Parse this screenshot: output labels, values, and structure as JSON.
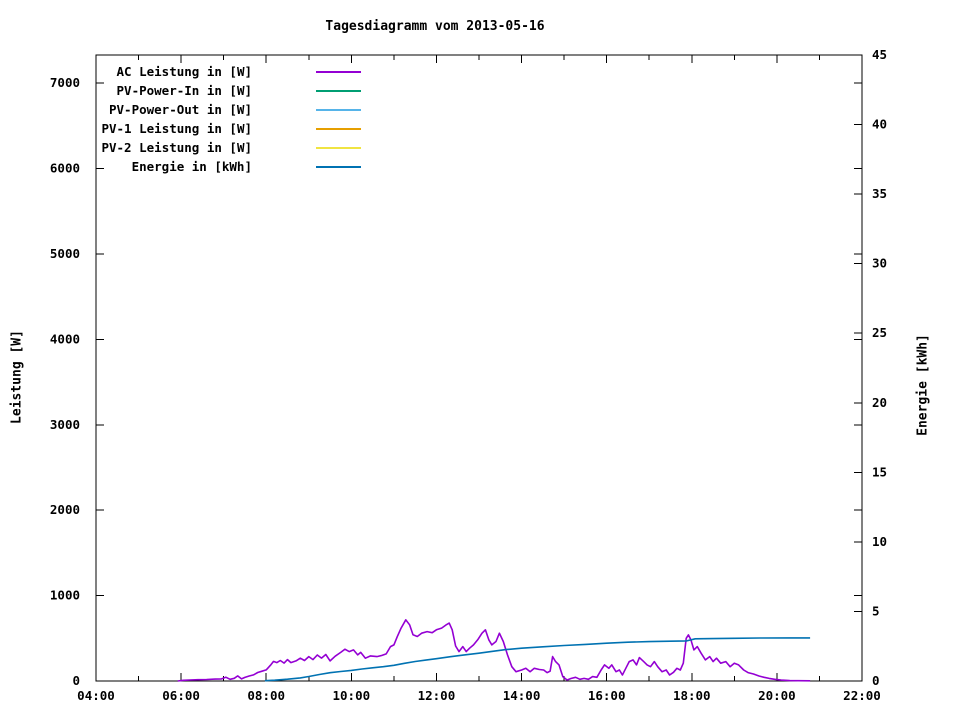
{
  "colors": {
    "background": "#ffffff",
    "axis": "#000000",
    "text": "#000000"
  },
  "chart_data": {
    "type": "line",
    "title": "Tagesdiagramm vom 2013-05-16",
    "grid": false,
    "legend_position": "top-left-inside",
    "x_axis": {
      "label": "",
      "min_hour": 4,
      "max_hour": 22,
      "major_tick_hours": [
        4,
        6,
        8,
        10,
        12,
        14,
        16,
        18,
        20,
        22
      ],
      "major_tick_labels": [
        "04:00",
        "06:00",
        "08:00",
        "10:00",
        "12:00",
        "14:00",
        "16:00",
        "18:00",
        "20:00",
        "22:00"
      ],
      "minor_tick_hours": [
        5,
        7,
        9,
        11,
        13,
        15,
        17,
        19,
        21
      ]
    },
    "y_left_axis": {
      "label": "Leistung [W]",
      "min": 0,
      "max": 7330,
      "tick_values": [
        0,
        1000,
        2000,
        3000,
        4000,
        5000,
        6000,
        7000
      ],
      "tick_labels": [
        "0",
        "1000",
        "2000",
        "3000",
        "4000",
        "5000",
        "6000",
        "7000"
      ]
    },
    "y_right_axis": {
      "label": "Energie [kWh]",
      "min": 0,
      "max": 45,
      "tick_values": [
        0,
        5,
        10,
        15,
        20,
        25,
        30,
        35,
        40,
        45
      ],
      "tick_labels": [
        "0",
        "5",
        "10",
        "15",
        "20",
        "25",
        "30",
        "35",
        "40",
        "45"
      ]
    },
    "series": [
      {
        "name": "AC Leistung in [W]",
        "slug": "ac-leistung",
        "color": "#9400D3",
        "axis": "left",
        "points": [
          [
            5.92,
            0
          ],
          [
            6.05,
            8
          ],
          [
            6.2,
            12
          ],
          [
            6.4,
            15
          ],
          [
            6.6,
            18
          ],
          [
            6.8,
            22
          ],
          [
            6.95,
            25
          ],
          [
            7.05,
            45
          ],
          [
            7.15,
            20
          ],
          [
            7.25,
            32
          ],
          [
            7.33,
            60
          ],
          [
            7.42,
            25
          ],
          [
            7.5,
            42
          ],
          [
            7.6,
            58
          ],
          [
            7.7,
            72
          ],
          [
            7.8,
            100
          ],
          [
            7.9,
            115
          ],
          [
            8.0,
            130
          ],
          [
            8.1,
            185
          ],
          [
            8.17,
            230
          ],
          [
            8.25,
            215
          ],
          [
            8.33,
            240
          ],
          [
            8.42,
            210
          ],
          [
            8.5,
            250
          ],
          [
            8.58,
            215
          ],
          [
            8.7,
            235
          ],
          [
            8.8,
            267
          ],
          [
            8.9,
            240
          ],
          [
            9.0,
            286
          ],
          [
            9.1,
            250
          ],
          [
            9.2,
            305
          ],
          [
            9.3,
            268
          ],
          [
            9.4,
            310
          ],
          [
            9.5,
            235
          ],
          [
            9.62,
            290
          ],
          [
            9.75,
            335
          ],
          [
            9.85,
            372
          ],
          [
            9.95,
            344
          ],
          [
            10.05,
            364
          ],
          [
            10.15,
            306
          ],
          [
            10.22,
            335
          ],
          [
            10.33,
            267
          ],
          [
            10.45,
            294
          ],
          [
            10.6,
            286
          ],
          [
            10.72,
            300
          ],
          [
            10.82,
            317
          ],
          [
            10.92,
            403
          ],
          [
            11.0,
            423
          ],
          [
            11.08,
            520
          ],
          [
            11.17,
            620
          ],
          [
            11.28,
            717
          ],
          [
            11.37,
            658
          ],
          [
            11.45,
            541
          ],
          [
            11.55,
            521
          ],
          [
            11.65,
            560
          ],
          [
            11.78,
            579
          ],
          [
            11.9,
            565
          ],
          [
            12.0,
            599
          ],
          [
            12.12,
            619
          ],
          [
            12.22,
            655
          ],
          [
            12.3,
            678
          ],
          [
            12.37,
            600
          ],
          [
            12.45,
            410
          ],
          [
            12.53,
            344
          ],
          [
            12.62,
            403
          ],
          [
            12.7,
            344
          ],
          [
            12.78,
            384
          ],
          [
            12.87,
            423
          ],
          [
            12.97,
            482
          ],
          [
            13.07,
            560
          ],
          [
            13.15,
            600
          ],
          [
            13.23,
            482
          ],
          [
            13.3,
            423
          ],
          [
            13.4,
            462
          ],
          [
            13.48,
            560
          ],
          [
            13.57,
            462
          ],
          [
            13.67,
            306
          ],
          [
            13.77,
            168
          ],
          [
            13.87,
            109
          ],
          [
            14.0,
            129
          ],
          [
            14.1,
            149
          ],
          [
            14.2,
            109
          ],
          [
            14.3,
            149
          ],
          [
            14.42,
            135
          ],
          [
            14.52,
            129
          ],
          [
            14.6,
            98
          ],
          [
            14.67,
            115
          ],
          [
            14.73,
            286
          ],
          [
            14.8,
            227
          ],
          [
            14.88,
            188
          ],
          [
            14.97,
            51
          ],
          [
            15.07,
            12
          ],
          [
            15.17,
            31
          ],
          [
            15.27,
            43
          ],
          [
            15.37,
            20
          ],
          [
            15.47,
            31
          ],
          [
            15.57,
            20
          ],
          [
            15.67,
            51
          ],
          [
            15.77,
            43
          ],
          [
            15.87,
            129
          ],
          [
            15.95,
            188
          ],
          [
            16.05,
            149
          ],
          [
            16.12,
            188
          ],
          [
            16.22,
            109
          ],
          [
            16.3,
            129
          ],
          [
            16.37,
            70
          ],
          [
            16.45,
            149
          ],
          [
            16.53,
            227
          ],
          [
            16.62,
            247
          ],
          [
            16.7,
            188
          ],
          [
            16.77,
            274
          ],
          [
            16.87,
            227
          ],
          [
            16.95,
            188
          ],
          [
            17.03,
            168
          ],
          [
            17.12,
            227
          ],
          [
            17.2,
            168
          ],
          [
            17.3,
            109
          ],
          [
            17.4,
            129
          ],
          [
            17.48,
            70
          ],
          [
            17.57,
            102
          ],
          [
            17.65,
            149
          ],
          [
            17.73,
            129
          ],
          [
            17.8,
            208
          ],
          [
            17.87,
            500
          ],
          [
            17.92,
            540
          ],
          [
            17.98,
            482
          ],
          [
            18.05,
            364
          ],
          [
            18.13,
            403
          ],
          [
            18.22,
            325
          ],
          [
            18.32,
            247
          ],
          [
            18.42,
            286
          ],
          [
            18.5,
            227
          ],
          [
            18.58,
            267
          ],
          [
            18.68,
            208
          ],
          [
            18.8,
            227
          ],
          [
            18.9,
            168
          ],
          [
            19.0,
            208
          ],
          [
            19.1,
            188
          ],
          [
            19.22,
            129
          ],
          [
            19.32,
            98
          ],
          [
            19.45,
            82
          ],
          [
            19.58,
            59
          ],
          [
            19.7,
            43
          ],
          [
            19.82,
            31
          ],
          [
            19.95,
            20
          ],
          [
            20.1,
            10
          ],
          [
            20.3,
            5
          ],
          [
            20.5,
            3
          ],
          [
            20.78,
            2
          ]
        ]
      },
      {
        "name": "PV-Power-In in [W]",
        "slug": "pv-power-in",
        "color": "#009E73",
        "axis": "left",
        "points": []
      },
      {
        "name": "PV-Power-Out in [W]",
        "slug": "pv-power-out",
        "color": "#56B4E9",
        "axis": "left",
        "points": []
      },
      {
        "name": "PV-1 Leistung in [W]",
        "slug": "pv-1-leistung",
        "color": "#E69F00",
        "axis": "left",
        "points": []
      },
      {
        "name": "PV-2 Leistung in [W]",
        "slug": "pv-2-leistung",
        "color": "#F0E442",
        "axis": "left",
        "points": []
      },
      {
        "name": "Energie in [kWh]",
        "slug": "energie",
        "color": "#0072B2",
        "axis": "right",
        "points": [
          [
            7.97,
            0.02
          ],
          [
            8.2,
            0.06
          ],
          [
            8.5,
            0.13
          ],
          [
            8.8,
            0.22
          ],
          [
            9.0,
            0.32
          ],
          [
            9.25,
            0.47
          ],
          [
            9.5,
            0.6
          ],
          [
            9.75,
            0.68
          ],
          [
            10.0,
            0.76
          ],
          [
            10.25,
            0.86
          ],
          [
            10.5,
            0.95
          ],
          [
            10.75,
            1.03
          ],
          [
            11.0,
            1.13
          ],
          [
            11.25,
            1.27
          ],
          [
            11.5,
            1.4
          ],
          [
            11.75,
            1.5
          ],
          [
            12.0,
            1.6
          ],
          [
            12.33,
            1.75
          ],
          [
            12.63,
            1.86
          ],
          [
            13.0,
            2.0
          ],
          [
            13.3,
            2.13
          ],
          [
            13.63,
            2.26
          ],
          [
            14.0,
            2.36
          ],
          [
            14.5,
            2.46
          ],
          [
            15.0,
            2.55
          ],
          [
            15.5,
            2.63
          ],
          [
            16.0,
            2.72
          ],
          [
            16.5,
            2.79
          ],
          [
            17.0,
            2.83
          ],
          [
            17.5,
            2.86
          ],
          [
            17.88,
            2.88
          ],
          [
            18.08,
            3.03
          ],
          [
            18.5,
            3.05
          ],
          [
            19.0,
            3.07
          ],
          [
            19.6,
            3.09
          ],
          [
            20.3,
            3.1
          ],
          [
            20.78,
            3.1
          ]
        ]
      }
    ]
  }
}
